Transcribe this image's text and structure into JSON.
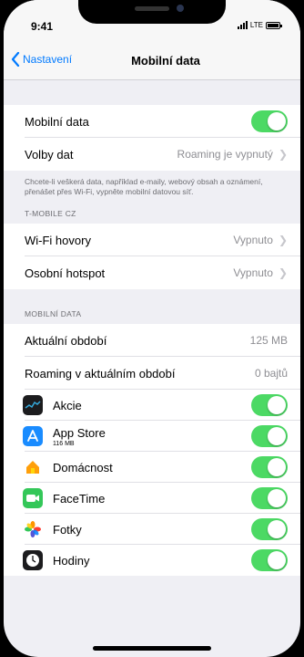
{
  "status": {
    "time": "9:41",
    "network": "LTE"
  },
  "nav": {
    "back_label": "Nastavení",
    "title": "Mobilní data"
  },
  "main": {
    "mobile_data_label": "Mobilní data",
    "data_options_label": "Volby dat",
    "data_options_value": "Roaming je vypnutý",
    "note": "Chcete-li veškerá data, například e-maily, webový obsah a oznámení, přenášet přes Wi-Fi, vypněte mobilní datovou síť."
  },
  "carrier": {
    "header": "T-MOBILE CZ",
    "wifi_calling_label": "Wi-Fi hovory",
    "wifi_calling_value": "Vypnuto",
    "hotspot_label": "Osobní hotspot",
    "hotspot_value": "Vypnuto"
  },
  "mobile_data_section": {
    "header": "MOBILNÍ DATA",
    "current_period_label": "Aktuální období",
    "current_period_value": "125 MB",
    "roaming_period_label": "Roaming v aktuálním období",
    "roaming_period_value": "0 bajtů"
  },
  "apps": [
    {
      "name": "Akcie",
      "usage": "",
      "icon": "stocks-icon",
      "color": "#1c1c1e",
      "enabled": true
    },
    {
      "name": "App Store",
      "usage": "116 MB",
      "icon": "app-store-icon",
      "color": "#1a8cff",
      "enabled": true
    },
    {
      "name": "Domácnost",
      "usage": "",
      "icon": "home-icon",
      "color": "#ffffff",
      "enabled": true
    },
    {
      "name": "FaceTime",
      "usage": "",
      "icon": "facetime-icon",
      "color": "#34c759",
      "enabled": true
    },
    {
      "name": "Fotky",
      "usage": "",
      "icon": "photos-icon",
      "color": "#ffffff",
      "enabled": true
    },
    {
      "name": "Hodiny",
      "usage": "",
      "icon": "clock-icon",
      "color": "#1c1c1e",
      "enabled": true
    }
  ],
  "colors": {
    "accent": "#007aff",
    "toggle_on": "#4cd964"
  }
}
